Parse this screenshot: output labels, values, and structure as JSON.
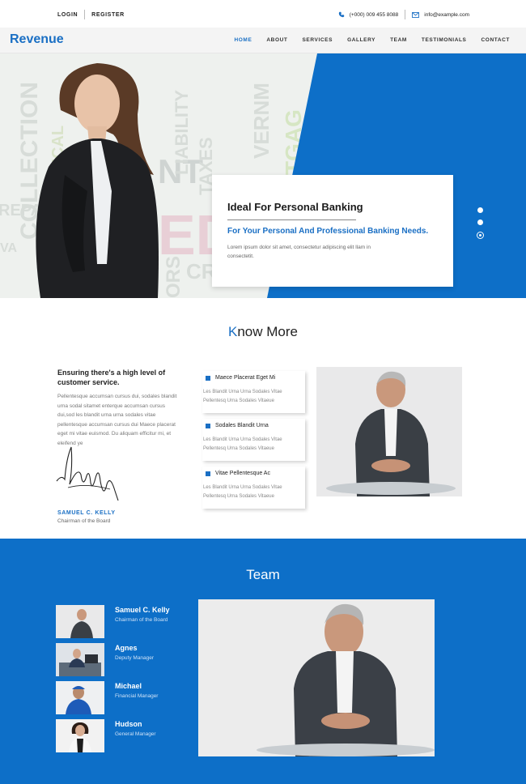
{
  "topbar": {
    "login": "LOGIN",
    "register": "REGISTER",
    "phone": "(+000) 009 455 8088",
    "email": "info@example.com"
  },
  "nav": {
    "logo": "Revenue",
    "items": [
      "HOME",
      "ABOUT",
      "SERVICES",
      "GALLERY",
      "TEAM",
      "TESTIMONIALS",
      "CONTACT"
    ],
    "active": "HOME"
  },
  "hero": {
    "title": "Ideal For Personal Banking",
    "subtitle": "For Your Personal And Professional Banking Needs.",
    "text": "Lorem ipsum dolor sit amet, consectetur adipiscing elit llam in consectetit.",
    "slide_count": 3,
    "active_slide": 3
  },
  "know_more": {
    "title_first": "K",
    "title_rest": "now More",
    "heading": "Ensuring there's a high level of customer service.",
    "body": "Pellentesque accumsan cursus dui, sodales blandit urna sodal sitamet enterque accumsan cursus dui,sod les blandit urna urna sodales vitae pellentesque accumsan cursus dui Maece placerat eget mi vitae euismod. Du aliquam efficitur mi, et eleifend ye",
    "signer_name": "SAMUEL C. KELLY",
    "signer_role": "Chairman of the Board",
    "features": [
      {
        "title": "Maece Placerat Eget Mi",
        "text": "Les Blandit Urna Urna Sodales Vitae Pellentesq Urna Sodales Vitaeue"
      },
      {
        "title": "Sodales Blandit Urna",
        "text": "Les Blandit Urna Urna Sodales Vitae Pellentesq Urna Sodales Vitaeue"
      },
      {
        "title": "Vitae Pellentesque Ac",
        "text": "Les Blandit Urna Urna Sodales Vitae Pellentesq Urna Sodales Vitaeue"
      }
    ]
  },
  "team": {
    "title": "Team",
    "members": [
      {
        "name": "Samuel C. Kelly",
        "role": "Chairman of the Board"
      },
      {
        "name": "Agnes",
        "role": "Deputy Manager"
      },
      {
        "name": "Michael",
        "role": "Financial Manager"
      },
      {
        "name": "Hudson",
        "role": "General Manager"
      }
    ]
  },
  "colors": {
    "accent": "#1a6fc4",
    "team_bg": "#0d6fc8"
  }
}
